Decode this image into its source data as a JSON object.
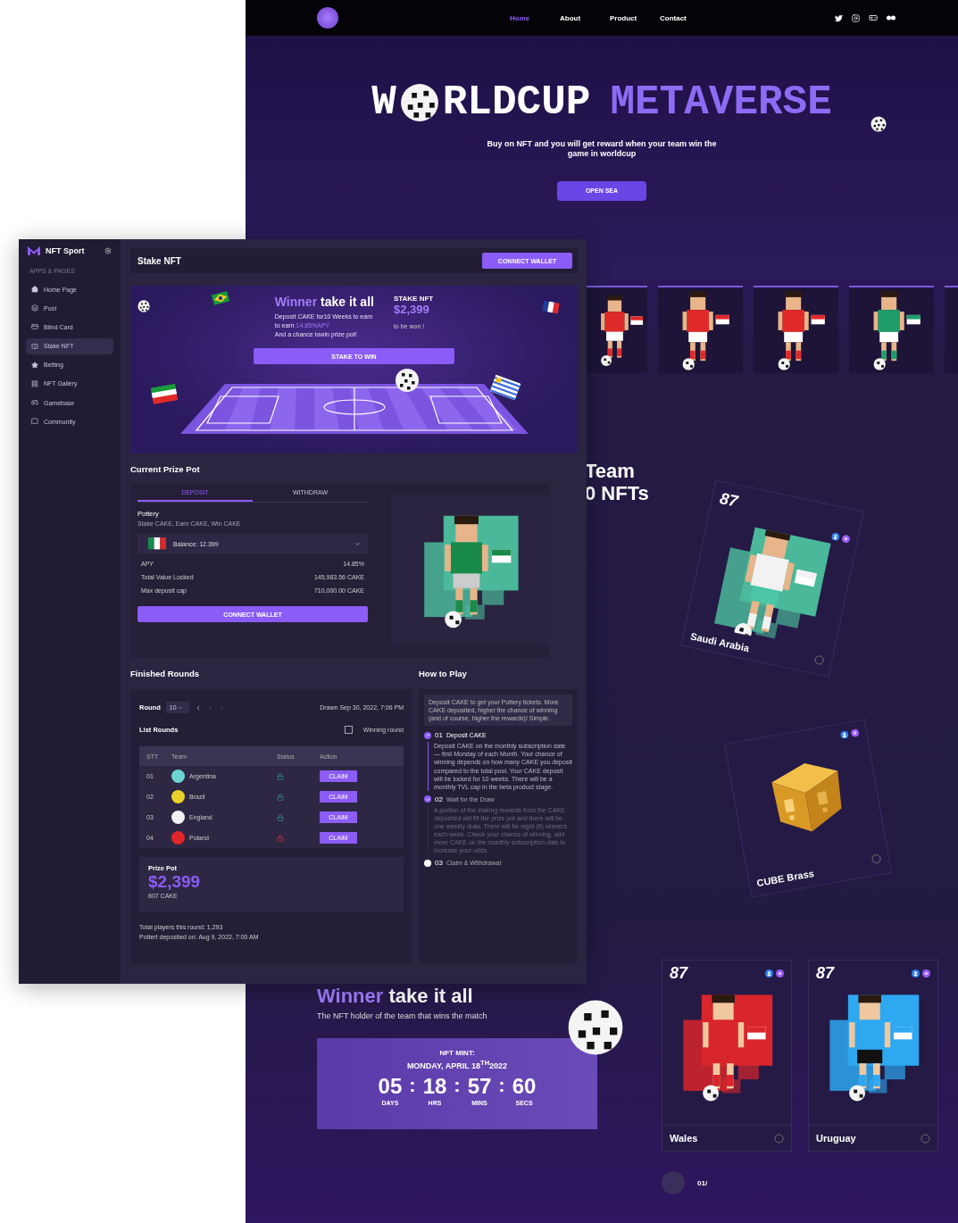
{
  "back_page": {
    "nav": {
      "items": [
        {
          "label": "Home",
          "selected": true
        },
        {
          "label": "About",
          "selected": false
        },
        {
          "label": "Product",
          "selected": false
        },
        {
          "label": "Contact",
          "selected": false
        }
      ]
    },
    "hero": {
      "title_start": "W",
      "title_rest": "RLDCUP",
      "title_accent": "METAVERSE",
      "subtitle": "Buy on NFT and you will get reward when your team win the game in worldcup",
      "button": "OPEN SEA"
    },
    "player_cards": [
      {
        "kind": "picture",
        "color": "#e02a2a"
      },
      {
        "kind": "picture",
        "color": "#e02a2a"
      },
      {
        "kind": "picture",
        "color": "#e02a2a"
      },
      {
        "kind": "picture",
        "color": "#1f9e6b"
      }
    ],
    "team_heading": [
      "Team",
      "0 NFTs"
    ],
    "featured_cards": [
      {
        "rating": "87",
        "name": "Saudi Arabia",
        "kind": "picture"
      },
      {
        "name": "CUBE Brass",
        "kind": "picture"
      }
    ],
    "mint": {
      "title_accent": "Winner",
      "title_rest": "take it all",
      "subtitle": "The NFT holder of the team that wins the match",
      "label": "NFT MINT:",
      "date": "MONDAY, APRIL 18$^{TH}$2022",
      "separator": ":",
      "countdown": [
        {
          "value": "05",
          "unit": "DAYS"
        },
        {
          "value": "18",
          "unit": "HRS"
        },
        {
          "value": "57",
          "unit": "MINS"
        },
        {
          "value": "60",
          "unit": "SECS"
        }
      ]
    },
    "team_cards": [
      {
        "rating": "87",
        "name": "Wales",
        "color": "#d8262c"
      },
      {
        "rating": "87",
        "name": "Uruguay",
        "color": "#2ea8f0"
      }
    ],
    "pager": "01/"
  },
  "dashboard": {
    "brand": "NFT Sport",
    "section_label": "APPS & PAGES",
    "sidebar_items": [
      {
        "label": "Home Page",
        "kind": "home",
        "selected": false
      },
      {
        "label": "Pool",
        "kind": "layers",
        "selected": false
      },
      {
        "label": "Blind Card",
        "kind": "card",
        "selected": false
      },
      {
        "label": "Stake NFT",
        "kind": "ticket",
        "selected": true
      },
      {
        "label": "Betting",
        "kind": "star",
        "selected": false
      },
      {
        "label": "NFT Gallery",
        "kind": "gallery",
        "selected": false
      },
      {
        "label": "Gamebase",
        "kind": "gamepad",
        "selected": false
      },
      {
        "label": "Community",
        "kind": "chat",
        "selected": false
      }
    ],
    "header": {
      "title": "Stake NFT",
      "button": "CONNECT WALLET"
    },
    "banner": {
      "title_accent": "Winner",
      "title_rest": "take it all",
      "description": [
        {
          "text": "Deposit CAKE for10 Weeks to earn"
        },
        {
          "text": "to earn ",
          "accent": "14.85%APY"
        },
        {
          "text": "And a chance towin prize pot!"
        }
      ],
      "stake_label": "STAKE NFT",
      "amount": "$2,399",
      "amount_note": "to be won !",
      "button": "STAKE TO WIN"
    },
    "prize_pot": {
      "title": "Current Prize Pot",
      "tabs": [
        {
          "label": "DEPOSIT",
          "selected": true
        },
        {
          "label": "WITHDRAW",
          "selected": false
        }
      ],
      "name": "Pottery",
      "tagline": "Stake CAKE, Earn CAKE, Win CAKE",
      "balance": "Balance: 12.399",
      "stats": [
        {
          "label": "APY",
          "value": "14.85%"
        },
        {
          "label": "Total Value Locked",
          "value": "145,983.56 CAKE"
        },
        {
          "label": "Max deposit cap",
          "value": "710,000.00 CAKE"
        }
      ],
      "button": "CONNECT WALLET"
    },
    "finished_rounds": {
      "title": "Finished Rounds",
      "round_label": "Round",
      "round_value": "10",
      "drawn": "Drawn Sep 30, 2022, 7:06 PM",
      "list_title": "List Rounds",
      "winning_filter": {
        "label": "Winning round",
        "checked": false
      },
      "columns": [
        "STT",
        "Team",
        "Status",
        "Action"
      ],
      "rows": [
        {
          "stt": "01",
          "team": "Argentina",
          "color": "#6fd3d3",
          "won": true,
          "action": "CLAIM"
        },
        {
          "stt": "02",
          "team": "Brazil",
          "color": "#e8d12a",
          "won": true,
          "action": "CLAIM"
        },
        {
          "stt": "03",
          "team": "England",
          "color": "#f2f2f2",
          "won": true,
          "action": "CLAIM"
        },
        {
          "stt": "04",
          "team": "Poland",
          "color": "#e0262b",
          "won": false,
          "action": "CLAIM"
        }
      ],
      "prize": {
        "title": "Prize Pot",
        "amount": "$2,399",
        "sub": "607 CAKE"
      },
      "footer": [
        "Total players this round: 1,293",
        "Pottert deposited on: Aug 9, 2022, 7:00 AM"
      ]
    },
    "how_to_play": {
      "title": "How to Play",
      "intro": "Deposit CAKE to get your Pottery tickets. More CAKE deposited, higher the chance of winning (and of course, higher the rewards)! Simple.",
      "steps": [
        {
          "number": "01",
          "title": "Deposit CAKE",
          "done": true,
          "active": true,
          "text": "Deposit CAKE on the monthly subscription date — first Monday of each Month. Your chance of winning depends on how many CAKE you deposit compared to the total pool. Your CAKE deposit will be locked for 10 weeks. There will be a monthly TVL cap in the beta product stage."
        },
        {
          "number": "02",
          "title": "Wait for the Draw",
          "done": true,
          "active": false,
          "text": "A portion of the staking rewards from the CAKE deposited will fill the prize pot and there will be one weekly draw. There will be eight (8) winners each week. Check your chance of winning, add more CAKE on the monthly subscription date to increase your odds."
        },
        {
          "number": "03",
          "title": "Claim & Withdrawal",
          "done": false,
          "active": false
        }
      ]
    }
  }
}
